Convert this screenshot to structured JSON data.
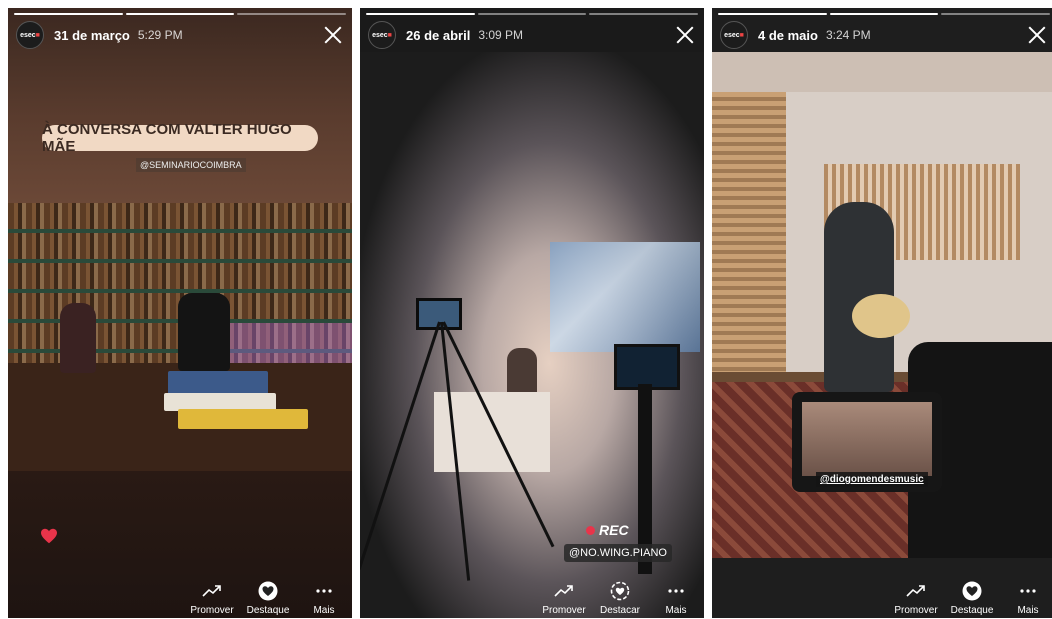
{
  "colors": {
    "accent_red": "#e8344a",
    "background": "#ffffff"
  },
  "account": {
    "avatar_text_main": "esec",
    "avatar_text_accent": "■"
  },
  "stories": [
    {
      "date": "31 de março",
      "time": "5:29 PM",
      "title": "À CONVERSA COM VALTER HUGO MÃE",
      "mention": "@SEMINARIOCOIMBRA",
      "like_icon": "heart-icon",
      "actions": [
        {
          "label": "Promover",
          "icon": "trending-up-icon"
        },
        {
          "label": "Destaque",
          "icon": "highlight-heart-icon"
        },
        {
          "label": "Mais",
          "icon": "more-dots-icon"
        }
      ]
    },
    {
      "date": "26 de abril",
      "time": "3:09 PM",
      "rec_label": "REC",
      "mention": "@NO.WING.PIANO",
      "actions": [
        {
          "label": "Promover",
          "icon": "trending-up-icon"
        },
        {
          "label": "Destacar",
          "icon": "highlight-add-icon"
        },
        {
          "label": "Mais",
          "icon": "more-dots-icon"
        }
      ]
    },
    {
      "date": "4 de maio",
      "time": "3:24 PM",
      "mention": "@diogomendesmusic",
      "actions": [
        {
          "label": "Promover",
          "icon": "trending-up-icon"
        },
        {
          "label": "Destaque",
          "icon": "highlight-heart-icon"
        },
        {
          "label": "Mais",
          "icon": "more-dots-icon"
        }
      ]
    }
  ]
}
